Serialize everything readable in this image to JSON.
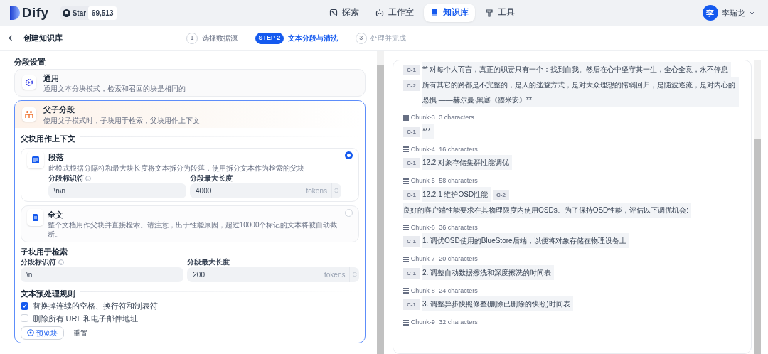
{
  "header": {
    "logo": "Dify",
    "github": {
      "label": "Star",
      "count": "69,513"
    },
    "nav": [
      {
        "label": "探索",
        "selected": false
      },
      {
        "label": "工作室",
        "selected": false
      },
      {
        "label": "知识库",
        "selected": true
      },
      {
        "label": "工具",
        "selected": false
      }
    ],
    "user": {
      "initial": "李",
      "name": "李瑞龙"
    }
  },
  "steps_bar": {
    "back_label": "创建知识库",
    "steps": [
      {
        "number": "1",
        "label": "选择数据源",
        "selected": false
      },
      {
        "number": "STEP 2",
        "label": "文本分段与清洗",
        "selected": true
      },
      {
        "number": "3",
        "label": "处理并完成",
        "selected": false
      }
    ]
  },
  "settings": {
    "title": "分段设置",
    "modes": [
      {
        "title": "通用",
        "description": "通用文本分块模式，检索和召回的块是相同的",
        "selected": false
      },
      {
        "title": "父子分段",
        "description": "使用父子模式时，子块用于检索，父块用作上下文",
        "selected": true
      }
    ],
    "parent_title": "父块用作上下文",
    "parent_options": [
      {
        "title": "段落",
        "description": "此模式根据分隔符和最大块长度将文本拆分为段落，使用拆分文本作为检索的父块",
        "selected": true,
        "fields": [
          {
            "label": "分段标识符",
            "value": "\\n\\n"
          },
          {
            "label": "分段最大长度",
            "value": "4000",
            "unit": "tokens"
          }
        ]
      },
      {
        "title": "全文",
        "description": "整个文档用作父块并直接检索。请注意，出于性能原因，超过10000个标记的文本将被自动截断。",
        "selected": false
      }
    ],
    "child_title": "子块用于检索",
    "child_fields": [
      {
        "label": "分段标识符",
        "value": "\\n"
      },
      {
        "label": "分段最大长度",
        "value": "200",
        "unit": "tokens"
      }
    ],
    "rules_title": "文本预处理规则",
    "rules": [
      {
        "label": "替换掉连续的空格、换行符和制表符",
        "checked": true
      },
      {
        "label": "删除所有 URL 和电子邮件地址",
        "checked": false
      }
    ],
    "preview_button": "预览块",
    "reset_button": "重置"
  },
  "preview": {
    "chunks": [
      {
        "segments": [
          {
            "label": "C-1",
            "text": "** 对每个人而言，真正的职责只有一个：找到自我。然后在心中坚守其一生，全心全意，永不停息"
          },
          {
            "label": "C-2",
            "text": "所有其它的路都是不完整的，是人的逃避方式，是对大众理想的懦弱回归，是随波逐流，是对内心的恐惧 ——赫尔曼·黑塞《德米安》**"
          }
        ]
      },
      {
        "name": "Chunk-3",
        "count": "3 characters",
        "segments": [
          {
            "label": "C-1",
            "text": "***"
          }
        ]
      },
      {
        "name": "Chunk-4",
        "count": "16 characters",
        "segments": [
          {
            "label": "C-1",
            "text": "12.2 对象存储集群性能调优"
          }
        ]
      },
      {
        "name": "Chunk-5",
        "count": "58 characters",
        "segments": [
          {
            "label": "C-1",
            "text": "12.2.1 维护OSD性能"
          },
          {
            "label": "C-2",
            "text": "良好的客户端性能要求在其物理限度内使用OSDs。为了保持OSD性能，评估以下调优机会:"
          }
        ]
      },
      {
        "name": "Chunk-6",
        "count": "36 characters",
        "segments": [
          {
            "label": "C-1",
            "text": "1. 调优OSD使用的BlueStore后端，以便将对象存储在物理设备上"
          }
        ]
      },
      {
        "name": "Chunk-7",
        "count": "20 characters",
        "segments": [
          {
            "label": "C-1",
            "text": "2. 调整自动数据擦洗和深度擦洗的时间表"
          }
        ]
      },
      {
        "name": "Chunk-8",
        "count": "24 characters",
        "segments": [
          {
            "label": "C-1",
            "text": "3. 调整异步快照修整(删除已删除的快照)时间表"
          }
        ]
      },
      {
        "name": "Chunk-9",
        "count": "32 characters"
      }
    ]
  }
}
